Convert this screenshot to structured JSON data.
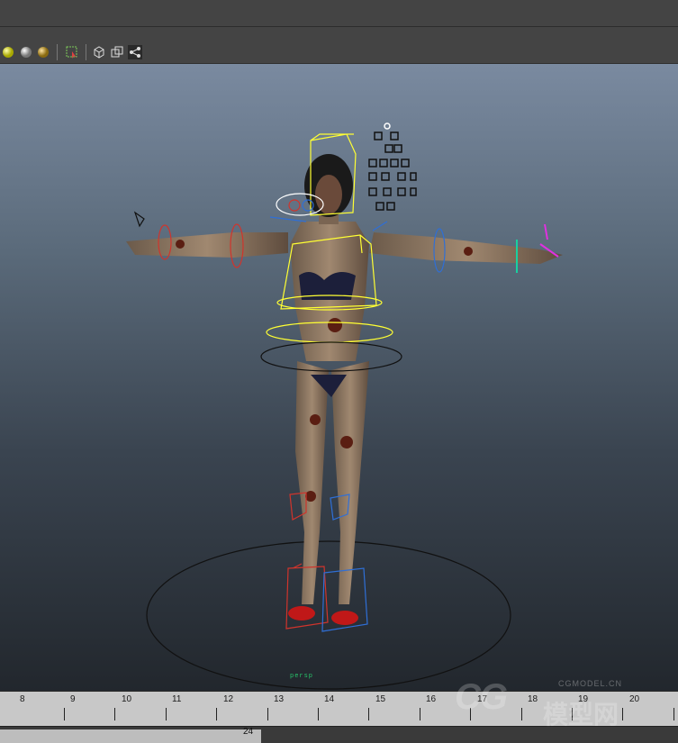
{
  "toolbar": {
    "icons": [
      "light-yellow-sphere-icon",
      "light-gray-sphere-icon",
      "light-gold-sphere-icon",
      "select-region-icon",
      "wireframe-cube-icon",
      "isolate-cube-icon",
      "share-nodes-icon"
    ]
  },
  "viewport": {
    "hud_label": "persp",
    "colors": {
      "ik_left": "#d0342c",
      "ik_right": "#2f6fd6",
      "control": "#ffff33",
      "root": "#111111"
    }
  },
  "timeline": {
    "ticks": [
      "8",
      "9",
      "10",
      "11",
      "12",
      "13",
      "14",
      "15",
      "16",
      "17",
      "18",
      "19",
      "20"
    ]
  },
  "range_bar": {
    "end_frame": "24"
  },
  "watermark": {
    "site": "CGMODEL.CN",
    "brand": "CG",
    "cn_text": "模型网"
  }
}
